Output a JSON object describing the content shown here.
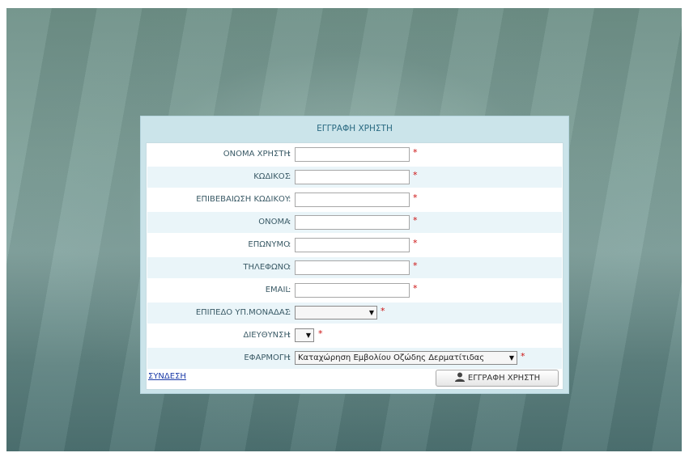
{
  "panel": {
    "title": "ΕΓΓΡΑΦΗ ΧΡΗΣΤΗ"
  },
  "form": {
    "colon": ":",
    "required_mark": "*",
    "fields": [
      {
        "label": "ΟΝΟΜΑ ΧΡΗΣΤΗ",
        "value": ""
      },
      {
        "label": "ΚΩΔΙΚΟΣ",
        "value": ""
      },
      {
        "label": "ΕΠΙΒΕΒΑΙΩΣΗ ΚΩΔΙΚΟΥ",
        "value": ""
      },
      {
        "label": "ΟΝΟΜΑ",
        "value": ""
      },
      {
        "label": "ΕΠΩΝΥΜΟ",
        "value": ""
      },
      {
        "label": "ΤΗΛΕΦΩΝΟ",
        "value": ""
      },
      {
        "label": "EMAIL",
        "value": ""
      }
    ],
    "selects": [
      {
        "label": "ΕΠΙΠΕΔΟ ΥΠ.ΜΟΝΑΔΑΣ",
        "value": ""
      },
      {
        "label": "ΔΙΕΥΘΥΝΣΗ",
        "value": ""
      },
      {
        "label": "ΕΦΑΡΜΟΓΗ",
        "value": "Καταχώρηση Εμβολίου Οζώδης Δερματίτιδας"
      }
    ],
    "arrow_glyph": "▼"
  },
  "footer": {
    "login_link": "ΣΥΝΔΕΣΗ",
    "register_button": "ΕΓΓΡΑΦΗ ΧΡΗΣΤΗ",
    "register_icon": "user-icon"
  }
}
